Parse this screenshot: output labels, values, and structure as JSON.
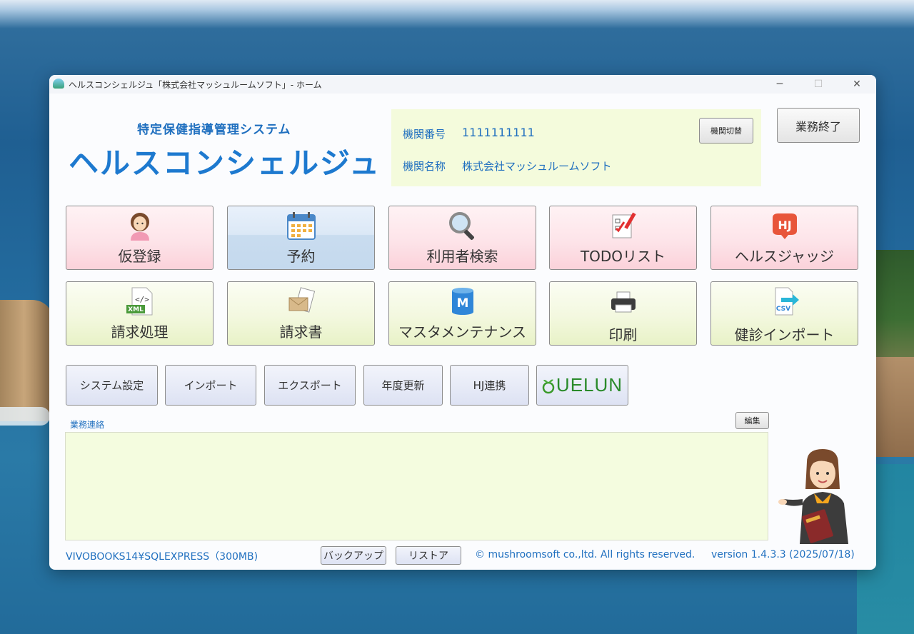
{
  "window": {
    "title": "ヘルスコンシェルジュ「株式会社マッシュルームソフト」- ホーム",
    "controls": {
      "minimize": "─",
      "maximize": "☐",
      "close": "✕"
    }
  },
  "header": {
    "subtitle": "特定保健指導管理システム",
    "app_name": "ヘルスコンシェルジュ"
  },
  "org": {
    "number_label": "機関番号",
    "number_value": "1111111111",
    "name_label": "機関名称",
    "name_value": "株式会社マッシュルームソフト",
    "switch_button": "機関切替"
  },
  "end_button": "業務終了",
  "tiles_row1": [
    {
      "label": "仮登録",
      "icon": "person-icon"
    },
    {
      "label": "予約",
      "icon": "calendar-icon"
    },
    {
      "label": "利用者検索",
      "icon": "magnifier-icon"
    },
    {
      "label": "TODOリスト",
      "icon": "checklist-icon"
    },
    {
      "label": "ヘルスジャッジ",
      "icon": "hj-icon"
    }
  ],
  "tiles_row2": [
    {
      "label": "請求処理",
      "icon": "xml-file-icon",
      "icon_text": "XML"
    },
    {
      "label": "請求書",
      "icon": "invoice-icon"
    },
    {
      "label": "マスタメンテナンス",
      "icon": "database-icon",
      "icon_text": "M"
    },
    {
      "label": "印刷",
      "icon": "printer-icon"
    },
    {
      "label": "健診インポート",
      "icon": "csv-import-icon",
      "icon_text": "CSV"
    }
  ],
  "hj_icon_text": "HJ",
  "small_buttons": [
    "システム設定",
    "インポート",
    "エクスポート",
    "年度更新",
    "HJ連携",
    "UELUN"
  ],
  "memo": {
    "label": "業務連絡",
    "edit_button": "編集"
  },
  "footer": {
    "server": "VIVOBOOKS14¥SQLEXPRESS（300MB)",
    "backup_button": "バックアップ",
    "restore_button": "リストア",
    "copyright": "© mushroomsoft co.,ltd. All rights reserved.",
    "version": "version 1.4.3.3 (2025/07/18)"
  },
  "colors": {
    "accent": "#1d79cf",
    "pink_tile": "#fde4e9",
    "green_tile": "#f3f8df",
    "blue_tile": "#dbe8f6",
    "memo_bg": "#f4fcdf"
  }
}
